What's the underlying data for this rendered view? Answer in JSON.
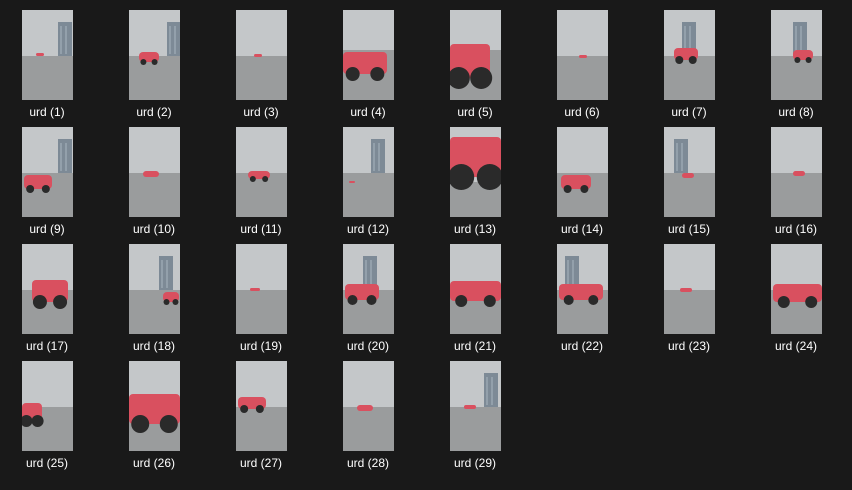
{
  "files": [
    {
      "name": "urd (1)",
      "icon": "video-thumbnail-icon"
    },
    {
      "name": "urd (2)",
      "icon": "video-thumbnail-icon"
    },
    {
      "name": "urd (3)",
      "icon": "video-thumbnail-icon"
    },
    {
      "name": "urd (4)",
      "icon": "video-thumbnail-icon"
    },
    {
      "name": "urd (5)",
      "icon": "video-thumbnail-icon"
    },
    {
      "name": "urd (6)",
      "icon": "video-thumbnail-icon"
    },
    {
      "name": "urd (7)",
      "icon": "video-thumbnail-icon"
    },
    {
      "name": "urd (8)",
      "icon": "video-thumbnail-icon"
    },
    {
      "name": "urd (9)",
      "icon": "video-thumbnail-icon"
    },
    {
      "name": "urd (10)",
      "icon": "video-thumbnail-icon"
    },
    {
      "name": "urd (11)",
      "icon": "video-thumbnail-icon"
    },
    {
      "name": "urd (12)",
      "icon": "video-thumbnail-icon"
    },
    {
      "name": "urd (13)",
      "icon": "video-thumbnail-icon"
    },
    {
      "name": "urd (14)",
      "icon": "video-thumbnail-icon"
    },
    {
      "name": "urd (15)",
      "icon": "video-thumbnail-icon"
    },
    {
      "name": "urd (16)",
      "icon": "video-thumbnail-icon"
    },
    {
      "name": "urd (17)",
      "icon": "video-thumbnail-icon"
    },
    {
      "name": "urd (18)",
      "icon": "video-thumbnail-icon"
    },
    {
      "name": "urd (19)",
      "icon": "video-thumbnail-icon"
    },
    {
      "name": "urd (20)",
      "icon": "video-thumbnail-icon"
    },
    {
      "name": "urd (21)",
      "icon": "video-thumbnail-icon"
    },
    {
      "name": "urd (22)",
      "icon": "video-thumbnail-icon"
    },
    {
      "name": "urd (23)",
      "icon": "video-thumbnail-icon"
    },
    {
      "name": "urd (24)",
      "icon": "video-thumbnail-icon"
    },
    {
      "name": "urd (25)",
      "icon": "video-thumbnail-icon"
    },
    {
      "name": "urd (26)",
      "icon": "video-thumbnail-icon"
    },
    {
      "name": "urd (27)",
      "icon": "video-thumbnail-icon"
    },
    {
      "name": "urd (28)",
      "icon": "video-thumbnail-icon"
    },
    {
      "name": "urd (29)",
      "icon": "video-thumbnail-icon"
    }
  ],
  "colors": {
    "background": "#191919",
    "label_text": "#ffffff",
    "sky": "#c4c7c9",
    "ground": "#9a9c9d",
    "building": "#7d8a96",
    "car": "#d9505f",
    "tire": "#2a2a2a"
  }
}
